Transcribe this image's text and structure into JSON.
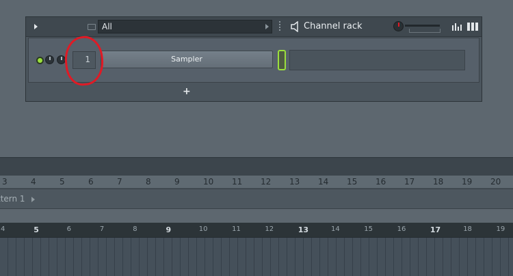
{
  "channel_rack": {
    "filter_value": "All",
    "title": "Channel rack",
    "channel": {
      "number": "1",
      "name": "Sampler"
    },
    "add_label": "+"
  },
  "timeline": {
    "ruler_numbers": [
      "3",
      "4",
      "5",
      "6",
      "7",
      "8",
      "9",
      "10",
      "11",
      "12",
      "13",
      "14",
      "15",
      "16",
      "17",
      "18",
      "19",
      "20"
    ],
    "pattern_label": "ttern 1",
    "playlist_numbers": [
      "4",
      "5",
      "6",
      "7",
      "8",
      "9",
      "10",
      "11",
      "12",
      "13",
      "14",
      "15",
      "16",
      "17",
      "18",
      "19"
    ]
  },
  "colors": {
    "accent_green": "#9be03c",
    "annotation_red": "#e01a25"
  }
}
